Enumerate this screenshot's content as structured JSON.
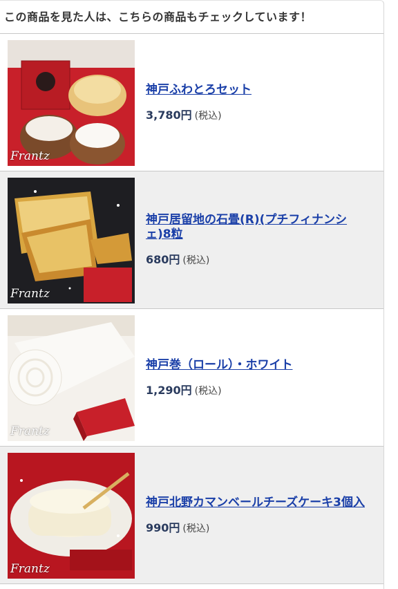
{
  "header": {
    "title": "この商品を見た人は、こちらの商品もチェックしています！"
  },
  "items": [
    {
      "name": "神戸ふわとろセット",
      "price": "3,780円",
      "tax": "(税込)",
      "brand": "Frantz",
      "image_icon": "cake-set-photo"
    },
    {
      "name": "神戸居留地の石畳(R)(プチフィナンシェ)8粒",
      "price": "680円",
      "tax": "(税込)",
      "brand": "Frantz",
      "image_icon": "financier-photo"
    },
    {
      "name": "神戸巻（ロール）・ホワイト",
      "price": "1,290円",
      "tax": "(税込)",
      "brand": "Frantz",
      "image_icon": "roll-cake-photo"
    },
    {
      "name": "神戸北野カマンベールチーズケーキ3個入",
      "price": "990円",
      "tax": "(税込)",
      "brand": "Frantz",
      "image_icon": "cheesecake-photo"
    }
  ],
  "colors": {
    "link": "#1a3fa8",
    "price": "#2a3b5e",
    "alt_row": "#efefef"
  }
}
